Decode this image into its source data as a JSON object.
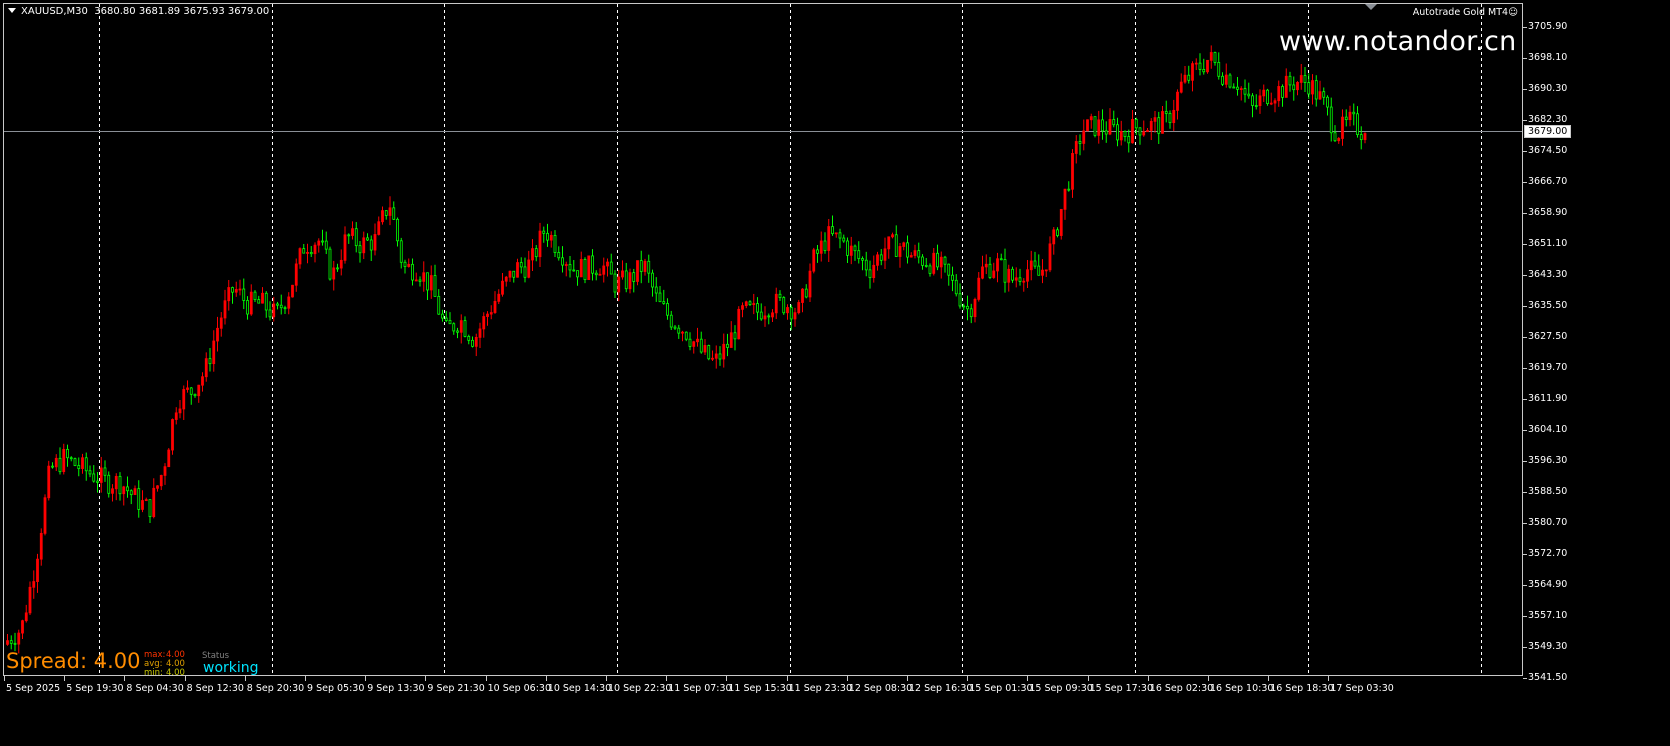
{
  "header": {
    "symbol": "XAUUSD,M30",
    "ohlc": "3680.80 3681.89 3675.93 3679.00",
    "expert_name": "Autotrade Gold MT4",
    "expert_icon": "smiley-icon",
    "watermark": "www.notandor.cn"
  },
  "indicator": {
    "spread_text": "Spread: 4.00",
    "max_label": "max:",
    "max_value": "4.00",
    "avg_label": "avg:",
    "avg_value": "4.00",
    "min_label": "min:",
    "min_value": "4.00",
    "status_label": "Status",
    "status_value": "working"
  },
  "colors": {
    "background": "#000000",
    "bull_candle": "#ff0000",
    "bear_candle": "#00ff00",
    "grid": "#ffffff",
    "bid_line": "#8a8f96",
    "spread": "#ff8c00",
    "max": "#ff3300",
    "avg": "#e0a000",
    "min": "#c8c800",
    "status": "#00e5ff"
  },
  "chart_data": {
    "type": "candlestick",
    "symbol": "XAUUSD",
    "timeframe": "M30",
    "current_price": "3679.00",
    "ylim": [
      3539.5,
      3712.0
    ],
    "y_ticks": [
      "3705.90",
      "3698.10",
      "3690.30",
      "3682.30",
      "3674.50",
      "3666.70",
      "3658.90",
      "3651.10",
      "3643.30",
      "3635.50",
      "3627.50",
      "3619.70",
      "3611.90",
      "3604.10",
      "3596.30",
      "3588.50",
      "3580.70",
      "3572.70",
      "3564.90",
      "3557.10",
      "3549.30",
      "3541.50"
    ],
    "x_ticks": [
      "5 Sep 2025",
      "5 Sep 19:30",
      "8 Sep 04:30",
      "8 Sep 12:30",
      "8 Sep 20:30",
      "9 Sep 05:30",
      "9 Sep 13:30",
      "9 Sep 21:30",
      "10 Sep 06:30",
      "10 Sep 14:30",
      "10 Sep 22:30",
      "11 Sep 07:30",
      "11 Sep 15:30",
      "11 Sep 23:30",
      "12 Sep 08:30",
      "12 Sep 16:30",
      "15 Sep 01:30",
      "15 Sep 09:30",
      "15 Sep 17:30",
      "16 Sep 02:30",
      "16 Sep 10:30",
      "16 Sep 18:30",
      "17 Sep 03:30"
    ],
    "grid": "vertical dashed",
    "approx_close_path": [
      3551,
      3554,
      3571,
      3594,
      3597,
      3595,
      3593,
      3591,
      3591,
      3587,
      3584,
      3594,
      3612,
      3614,
      3619,
      3632,
      3640,
      3636,
      3636,
      3633,
      3640,
      3651,
      3652,
      3643,
      3653,
      3651,
      3652,
      3662,
      3645,
      3645,
      3640,
      3629,
      3632,
      3627,
      3634,
      3640,
      3645,
      3646,
      3655,
      3650,
      3645,
      3645,
      3646,
      3641,
      3642,
      3646,
      3636,
      3632,
      3629,
      3624,
      3621,
      3626,
      3634,
      3634,
      3636,
      3636,
      3634,
      3647,
      3653,
      3652,
      3648,
      3645,
      3650,
      3651,
      3648,
      3647,
      3645,
      3640,
      3634,
      3645,
      3646,
      3642,
      3645,
      3643,
      3652,
      3667,
      3680,
      3681,
      3680,
      3679,
      3681,
      3681,
      3682,
      3691,
      3695,
      3698,
      3694,
      3692,
      3685,
      3689,
      3690,
      3692,
      3692,
      3687,
      3679,
      3682,
      3679
    ]
  }
}
